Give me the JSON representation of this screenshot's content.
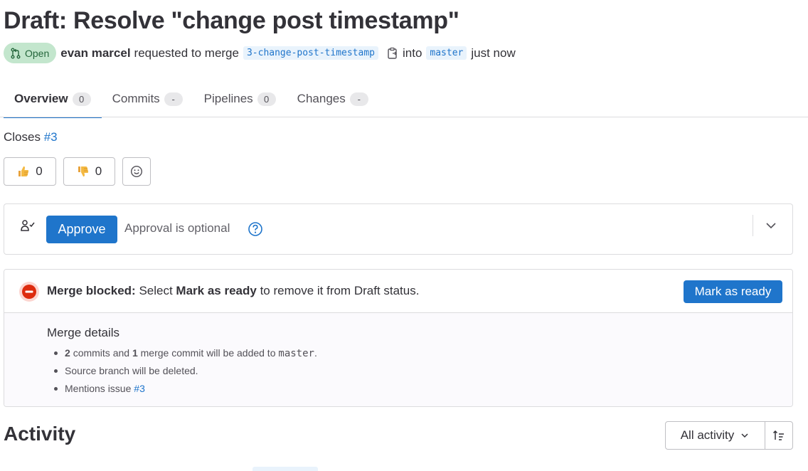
{
  "header": {
    "title": "Draft: Resolve \"change post timestamp\"",
    "status_badge": "Open",
    "author": "evan marcel",
    "requested_text": "requested to merge",
    "source_branch": "3-change-post-timestamp",
    "into_text": "into",
    "target_branch": "master",
    "time_text": "just now"
  },
  "tabs": [
    {
      "label": "Overview",
      "count": "0"
    },
    {
      "label": "Commits",
      "count": "-"
    },
    {
      "label": "Pipelines",
      "count": "0"
    },
    {
      "label": "Changes",
      "count": "-"
    }
  ],
  "description": {
    "closes_text": "Closes",
    "issue_link": "#3"
  },
  "awards": {
    "thumbs_up_count": "0",
    "thumbs_down_count": "0"
  },
  "approval": {
    "button_label": "Approve",
    "status_text": "Approval is optional"
  },
  "merge": {
    "blocked_label": "Merge blocked:",
    "text_1": "Select",
    "text_bold": "Mark as ready",
    "text_2": "to remove it from Draft status.",
    "mark_ready_label": "Mark as ready",
    "details_title": "Merge details",
    "details": {
      "commits_count": "2",
      "commits_text": "commits and",
      "merge_commit_count": "1",
      "merge_commit_text": "merge commit will be added to",
      "target": "master",
      "source_deleted": "Source branch will be deleted.",
      "mentions_text": "Mentions issue",
      "mentions_link": "#3"
    }
  },
  "activity": {
    "heading": "Activity",
    "filter_label": "All activity"
  },
  "icons": {
    "merge_request": "merge-request-icon",
    "copy": "copy-icon",
    "thumbs_up": "thumbs-up-icon",
    "thumbs_down": "thumbs-down-icon",
    "emoji": "smiley-icon",
    "approver": "user-check-icon",
    "help": "question-circle-icon",
    "chevron": "chevron-down-icon",
    "blocked": "status-blocked-icon",
    "sort": "sort-icon"
  },
  "colors": {
    "brand_blue": "#1f75cb",
    "open_badge_bg": "#c3e6cd",
    "open_badge_text": "#24663b",
    "blocked_red": "#dd2b0e"
  }
}
